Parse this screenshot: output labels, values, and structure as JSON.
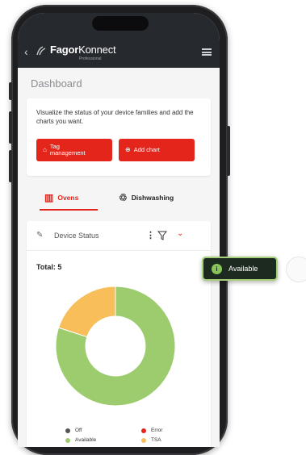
{
  "app": {
    "brand_bold": "Fagor",
    "brand_light": "Konnect",
    "brand_sub": "Professional"
  },
  "page": {
    "title": "Dashboard"
  },
  "intro": {
    "text": "Visualize the status of your device families and add the charts you want.",
    "tag_button": "Tag management",
    "add_chart_button": "Add chart"
  },
  "tabs": [
    {
      "label": "Ovens",
      "active": true
    },
    {
      "label": "Dishwashing",
      "active": false
    }
  ],
  "status_card": {
    "title": "Device Status",
    "total_label": "Total: 5"
  },
  "chart_data": {
    "type": "pie",
    "donut": true,
    "categories": [
      "Off",
      "Error",
      "Available",
      "TSA"
    ],
    "values": [
      0,
      0,
      4,
      1
    ],
    "colors": [
      "#555555",
      "#e3251c",
      "#9ccc6e",
      "#f7be5a"
    ],
    "legend_position": "bottom"
  },
  "tooltip": {
    "label": "Available"
  }
}
